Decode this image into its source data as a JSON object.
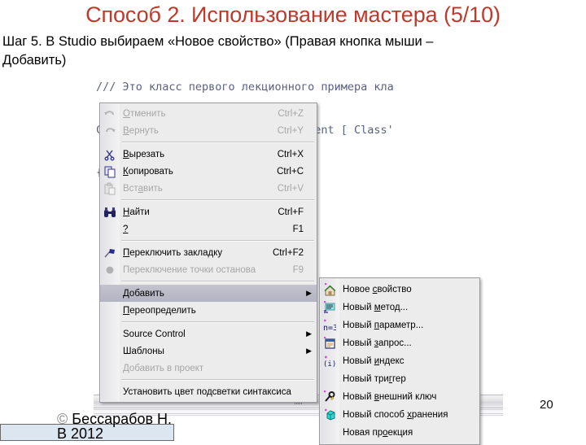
{
  "slide": {
    "title": "Способ 2. Использование мастера (5/10)",
    "step_line1": "Шаг 5. В Studio выбираем «Новое свойство» (Правая кнопка мыши –",
    "step_line2": "Добавить)",
    "page_number": "20",
    "title_color": "#BE3A2B"
  },
  "editor": {
    "code_line1": "/// Это класс первого лекционного примера кла",
    "code_line2": "Class User.Human Extends %Persistent [ Class'",
    "code_line3": "{",
    "code_color": "#5A5F80"
  },
  "context_menu": {
    "items": [
      {
        "label": "Отменить",
        "accel": "Ctrl+Z",
        "icon": "undo-icon",
        "disabled": true,
        "submenu": false,
        "selected": false
      },
      {
        "label": "Вернуть",
        "accel": "Ctrl+Y",
        "icon": "redo-icon",
        "disabled": true,
        "submenu": false,
        "selected": false
      },
      {
        "separator": true
      },
      {
        "label": "Вырезать",
        "accel": "Ctrl+X",
        "icon": "scissors-icon",
        "disabled": false,
        "submenu": false,
        "selected": false
      },
      {
        "label": "Копировать",
        "accel": "Ctrl+C",
        "icon": "copy-icon",
        "disabled": false,
        "submenu": false,
        "selected": false
      },
      {
        "label": "Вставить",
        "accel": "Ctrl+V",
        "icon": "paste-icon",
        "disabled": true,
        "submenu": false,
        "selected": false
      },
      {
        "separator": true
      },
      {
        "label": "Найти",
        "accel": "Ctrl+F",
        "icon": "binoculars-icon",
        "disabled": false,
        "submenu": false,
        "selected": false
      },
      {
        "label": "?",
        "accel": "F1",
        "icon": "none",
        "disabled": false,
        "submenu": false,
        "selected": false
      },
      {
        "separator": true
      },
      {
        "label": "Переключить закладку",
        "accel": "Ctrl+F2",
        "icon": "bookmark-flag-icon",
        "disabled": false,
        "submenu": false,
        "selected": false
      },
      {
        "label": "Переключение точки останова",
        "accel": "F9",
        "icon": "breakpoint-dot-icon",
        "disabled": true,
        "submenu": false,
        "selected": false
      },
      {
        "separator": true
      },
      {
        "label": "Добавить",
        "accel": "",
        "icon": "none",
        "disabled": false,
        "submenu": true,
        "selected": true
      },
      {
        "label": "Переопределить",
        "accel": "",
        "icon": "none",
        "disabled": false,
        "submenu": false,
        "selected": false
      },
      {
        "separator": true
      },
      {
        "label": "Source Control",
        "accel": "",
        "icon": "none",
        "disabled": false,
        "submenu": true,
        "selected": false
      },
      {
        "label": "Шаблоны",
        "accel": "",
        "icon": "none",
        "disabled": false,
        "submenu": true,
        "selected": false
      },
      {
        "label": "Добавить в проект",
        "accel": "",
        "icon": "none",
        "disabled": true,
        "submenu": false,
        "selected": false
      },
      {
        "separator": true
      },
      {
        "label": "Установить цвет подсветки синтаксиса",
        "accel": "",
        "icon": "none",
        "disabled": false,
        "submenu": false,
        "selected": false
      }
    ],
    "submenu_arrow": "▶",
    "highlight_color": "#B9B9C6"
  },
  "submenu": {
    "items": [
      {
        "label": "Новое свойство",
        "icon": "new-property-icon"
      },
      {
        "label": "Новый метод...",
        "icon": "new-method-icon"
      },
      {
        "label": "Новый параметр...",
        "icon": "new-parameter-icon"
      },
      {
        "label": "Новый запрос...",
        "icon": "new-query-icon"
      },
      {
        "label": "Новый индекс",
        "icon": "new-index-icon"
      },
      {
        "label": "Новый триггер",
        "icon": "none"
      },
      {
        "label": "Новый внешний ключ",
        "icon": "new-foreign-key-icon"
      },
      {
        "label": "Новый способ хранения",
        "icon": "new-storage-icon"
      },
      {
        "label": "Новая проекция",
        "icon": "none"
      }
    ]
  },
  "footer": {
    "copyright_mark": "©",
    "author": "Бессарабов Н.",
    "year_line": "В 2012"
  }
}
